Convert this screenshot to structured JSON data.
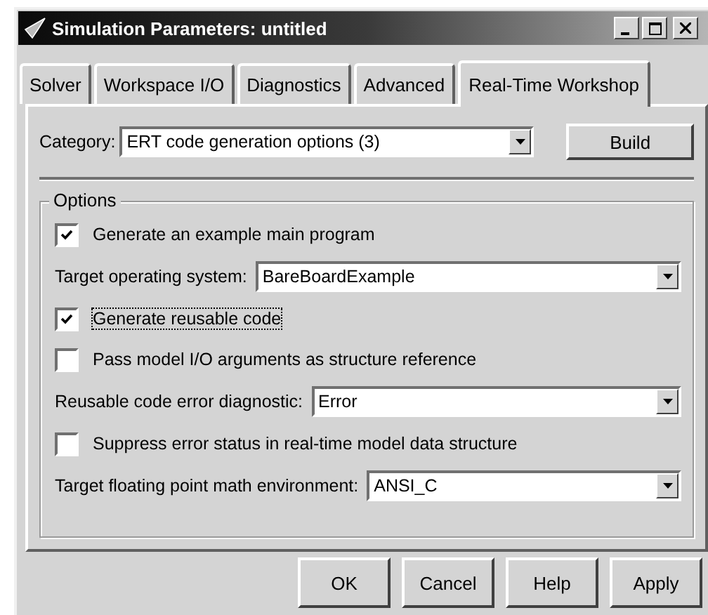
{
  "window": {
    "title": "Simulation Parameters: untitled"
  },
  "tabs": [
    {
      "label": "Solver",
      "selected": false
    },
    {
      "label": "Workspace I/O",
      "selected": false
    },
    {
      "label": "Diagnostics",
      "selected": false
    },
    {
      "label": "Advanced",
      "selected": false
    },
    {
      "label": "Real-Time Workshop",
      "selected": true
    }
  ],
  "category": {
    "label": "Category:",
    "value": "ERT code generation options (3)"
  },
  "build_button": "Build",
  "options": {
    "title": "Options",
    "items": [
      {
        "kind": "checkbox",
        "label": "Generate an example main program",
        "checked": true,
        "focused": false
      },
      {
        "kind": "dropdown",
        "label": "Target operating system:",
        "value": "BareBoardExample"
      },
      {
        "kind": "checkbox",
        "label": "Generate reusable code",
        "checked": true,
        "focused": true
      },
      {
        "kind": "checkbox",
        "label": "Pass model I/O arguments as structure reference",
        "checked": false,
        "focused": false
      },
      {
        "kind": "dropdown",
        "label": "Reusable code error diagnostic:",
        "value": "Error"
      },
      {
        "kind": "checkbox",
        "label": "Suppress error status in real-time model data structure",
        "checked": false,
        "focused": false
      },
      {
        "kind": "dropdown",
        "label": "Target floating point math environment:",
        "value": "ANSI_C"
      }
    ]
  },
  "buttons": [
    "OK",
    "Cancel",
    "Help",
    "Apply"
  ]
}
